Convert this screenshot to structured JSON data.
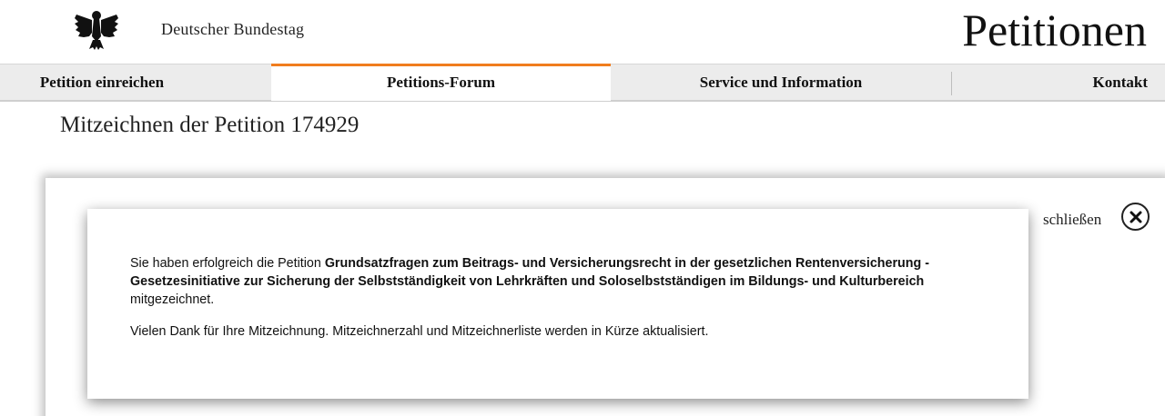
{
  "header": {
    "brand": "Deutscher Bundestag",
    "site_title": "Petitionen"
  },
  "nav": {
    "items": [
      {
        "label": "Petition einreichen"
      },
      {
        "label": "Petitions-Forum"
      },
      {
        "label": "Service und Information"
      },
      {
        "label": "Kontakt"
      }
    ],
    "active_index": 1
  },
  "page": {
    "heading": "Mitzeichnen der Petition 174929"
  },
  "overlay": {
    "close_label": "schließen"
  },
  "dialog": {
    "intro": "Sie haben erfolgreich die Petition ",
    "petition_title": "Grundsatzfragen zum Beitrags- und Versicherungsrecht in der gesetzlichen Rentenversicherung - Gesetzesinitiative zur Sicherung der Selbstständigkeit von Lehrkräften und Soloselbstständigen im Bildungs- und Kulturbereich",
    "outro": "mitgezeichnet.",
    "thanks": "Vielen Dank für Ihre Mitzeichnung. Mitzeichnerzahl und Mitzeichnerliste werden in Kürze aktualisiert."
  },
  "colors": {
    "accent": "#f07d1e",
    "nav_bg": "#ececec"
  }
}
